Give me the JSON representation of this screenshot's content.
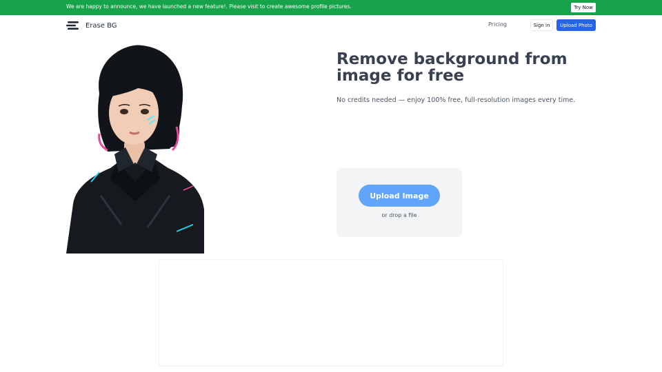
{
  "banner": {
    "text": "We are happy to announce, we have launched a new feature!. Please visit to create awesome profile pictures.",
    "cta_label": "Try Now",
    "bg_color": "#16a34a"
  },
  "header": {
    "logo_icon": "stacked-lines-logo-icon",
    "brand": "Erase BG",
    "nav_pricing": "Pricing",
    "signin_label": "Sign in",
    "upload_photo_label": "Upload Photo",
    "accent_color": "#2563eb"
  },
  "hero": {
    "image_description": "portrait",
    "title": "Remove background from image for free",
    "subtitle": "No credits needed — enjoy 100% free, full-resolution images every time."
  },
  "upload": {
    "button_label": "Upload Image",
    "drop_text": "or drop a file",
    "button_color": "#60a5fa"
  }
}
